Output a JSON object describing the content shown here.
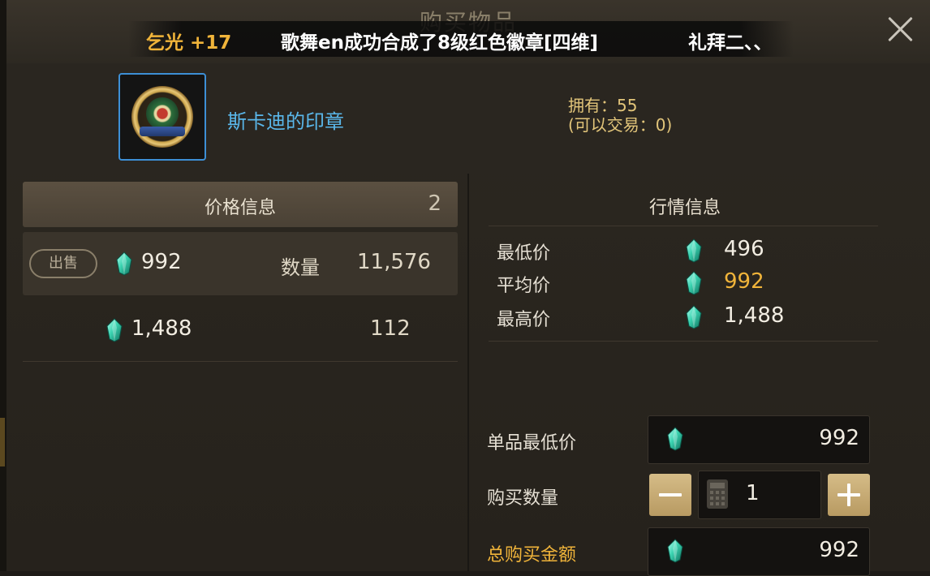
{
  "dialog": {
    "title": "购买物品"
  },
  "ticker": {
    "part_a": "乞光 +17",
    "part_b": "歌舞en成功合成了8级红色徽章[四维]",
    "part_c": "礼拜二、、"
  },
  "item": {
    "name": "斯卡迪的印章",
    "owned": "拥有：55",
    "tradeable": "(可以交易：0)"
  },
  "price_info": {
    "header": "价格信息",
    "count": "2",
    "rows": [
      {
        "sell_label": "出售",
        "price": "992",
        "qty_label": "数量",
        "qty": "11,576"
      },
      {
        "price": "1,488",
        "qty": "112"
      }
    ]
  },
  "market": {
    "title": "行情信息",
    "lowest_label": "最低价",
    "lowest": "496",
    "avg_label": "平均价",
    "avg": "992",
    "highest_label": "最高价",
    "highest": "1,488"
  },
  "purchase": {
    "unit_min_label": "单品最低价",
    "unit_min": "992",
    "qty_label": "购买数量",
    "qty": "1",
    "total_label": "总购买金额",
    "total": "992"
  },
  "colors": {
    "accent_gold": "#f0b43a",
    "item_blue": "#5ab7ea",
    "gem_teal": "#3ad3b0"
  },
  "icons": [
    "close-icon",
    "gem-icon",
    "calculator-icon",
    "minus-icon",
    "plus-icon"
  ]
}
